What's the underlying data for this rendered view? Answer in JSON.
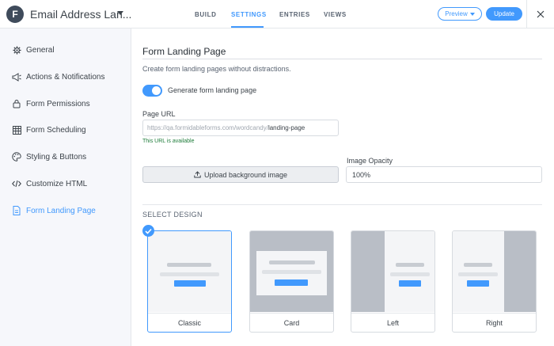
{
  "header": {
    "logo_letter": "F",
    "form_name": "Email Address Lan...",
    "tabs": [
      {
        "label": "BUILD"
      },
      {
        "label": "SETTINGS"
      },
      {
        "label": "ENTRIES"
      },
      {
        "label": "VIEWS"
      }
    ],
    "active_tab": "SETTINGS",
    "preview_label": "Preview",
    "update_label": "Update"
  },
  "sidebar": {
    "items": [
      {
        "label": "General",
        "icon": "gear-icon"
      },
      {
        "label": "Actions & Notifications",
        "icon": "megaphone-icon"
      },
      {
        "label": "Form Permissions",
        "icon": "lock-icon"
      },
      {
        "label": "Form Scheduling",
        "icon": "calendar-icon"
      },
      {
        "label": "Styling & Buttons",
        "icon": "palette-icon"
      },
      {
        "label": "Customize HTML",
        "icon": "code-icon"
      },
      {
        "label": "Form Landing Page",
        "icon": "file-icon"
      }
    ],
    "active_item": "Form Landing Page"
  },
  "main": {
    "title": "Form Landing Page",
    "description": "Create form landing pages without distractions.",
    "toggle_label": "Generate form landing page",
    "toggle_on": true,
    "page_url_label": "Page URL",
    "url_prefix": "https://qa.formidableforms.com/wordcandy/",
    "url_slug": "landing-page",
    "url_status": "This URL is available",
    "upload_label": "Upload background image",
    "opacity_label": "Image Opacity",
    "opacity_value": "100%",
    "select_design_label": "SELECT DESIGN",
    "designs": [
      {
        "label": "Classic",
        "selected": true
      },
      {
        "label": "Card",
        "selected": false
      },
      {
        "label": "Left",
        "selected": false
      },
      {
        "label": "Right",
        "selected": false
      }
    ]
  },
  "colors": {
    "accent": "#4199fd",
    "sidebar_bg": "#f6f7fb",
    "success": "#1e7c3a",
    "design_shade": "#b9bec6"
  }
}
